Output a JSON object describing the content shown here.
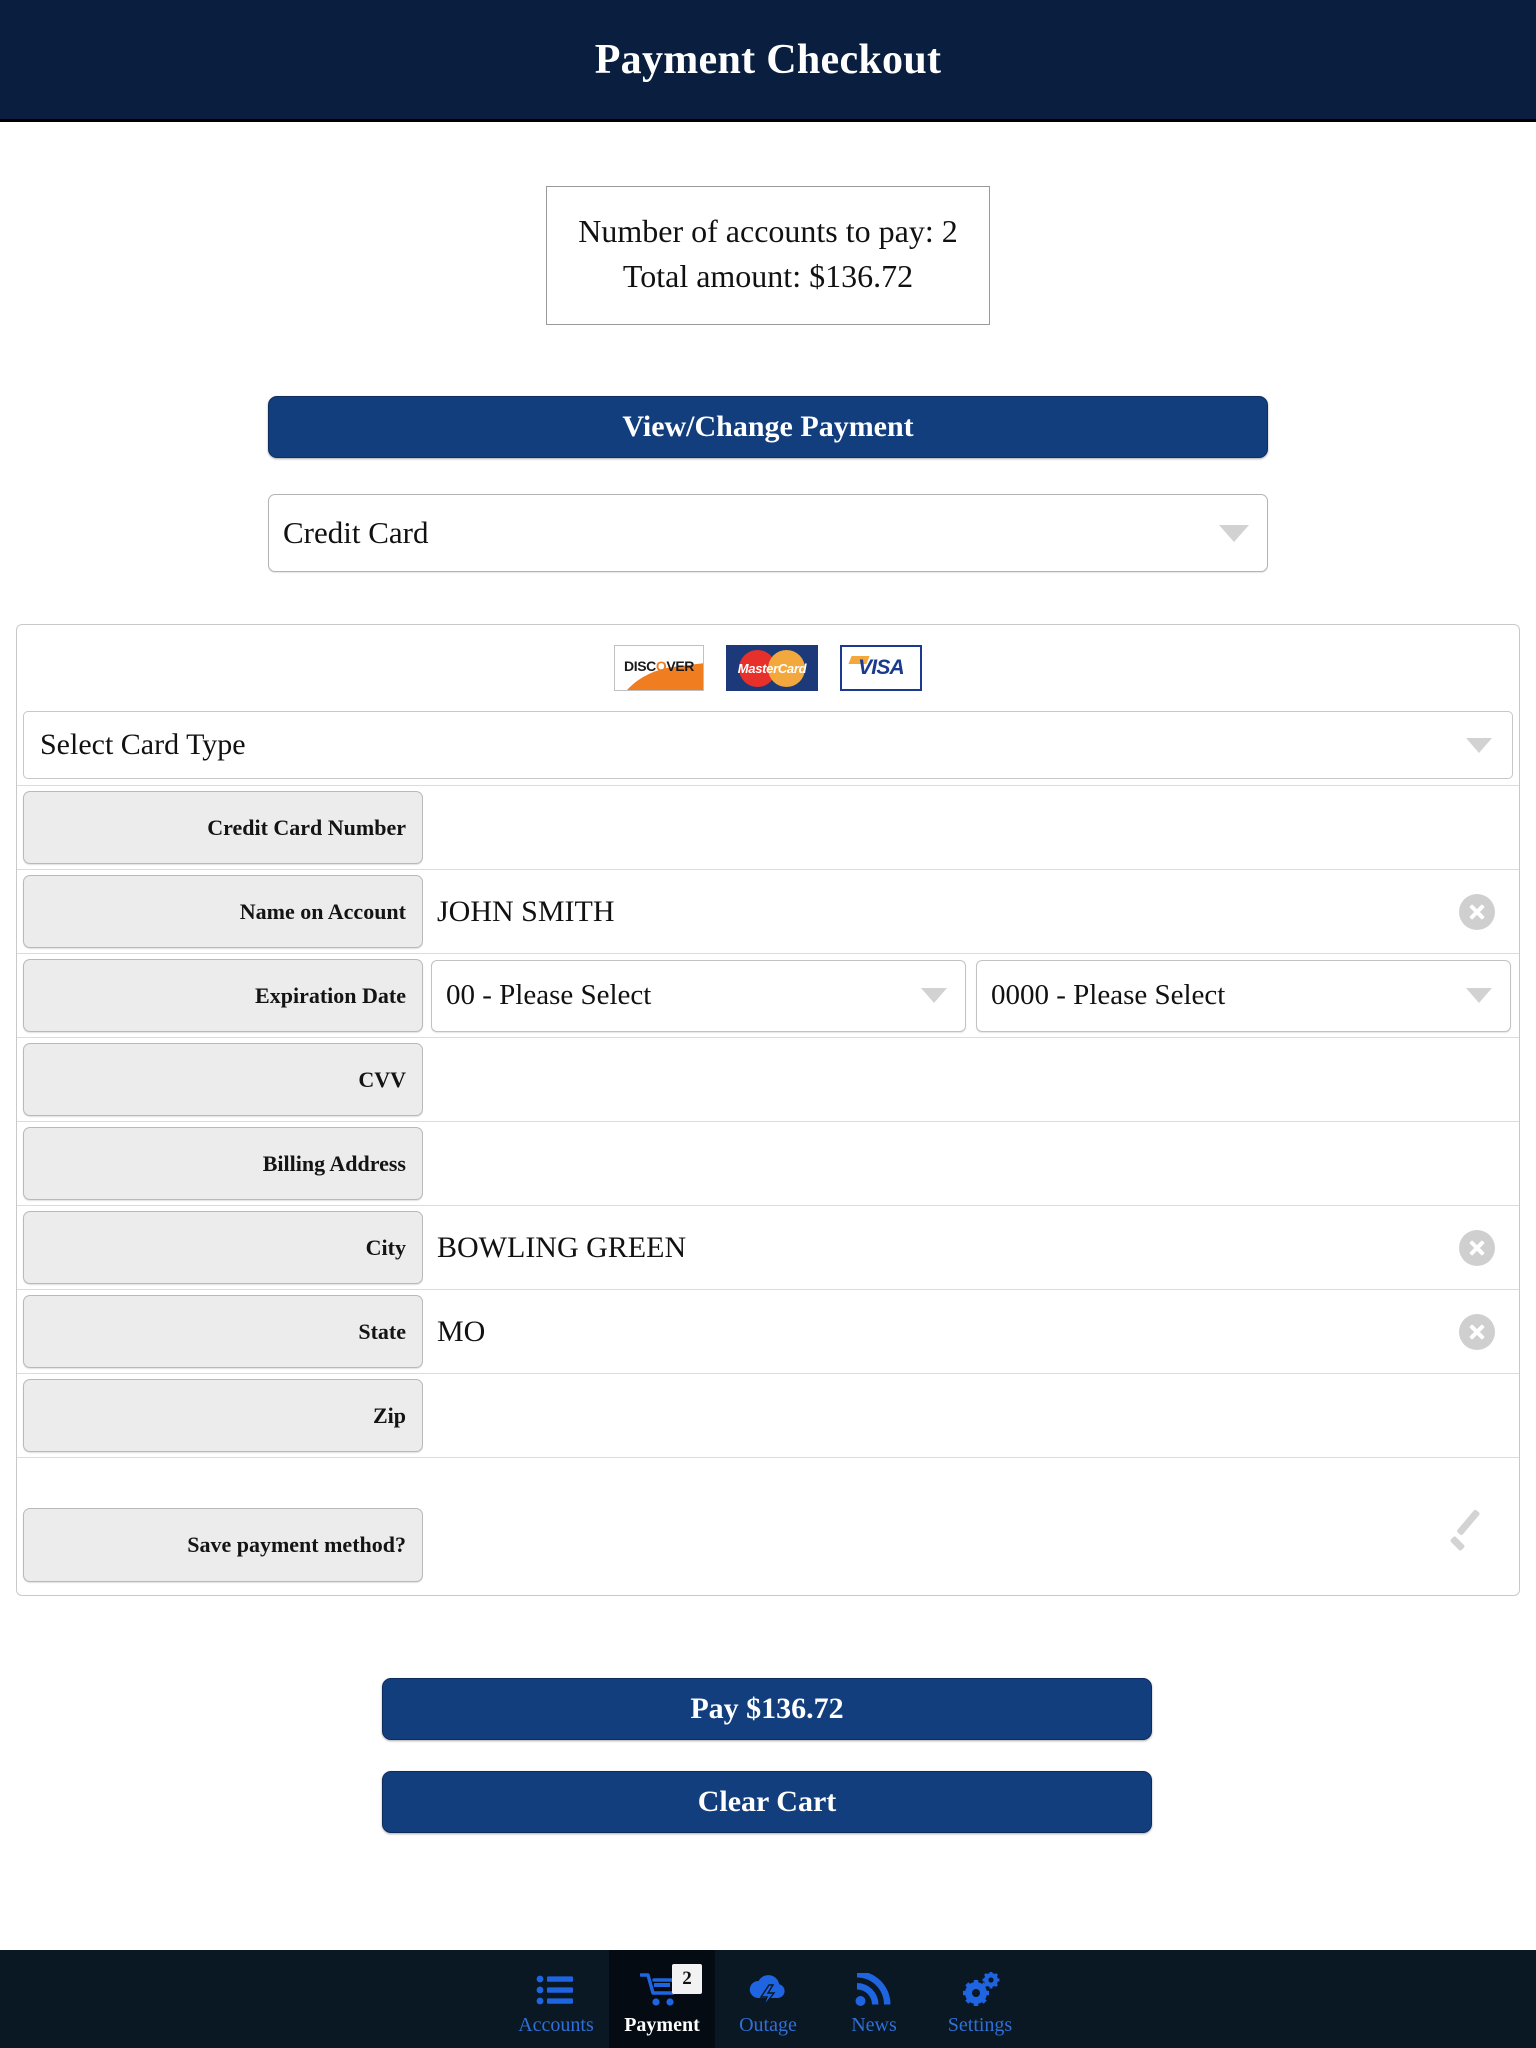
{
  "header": {
    "title": "Payment Checkout"
  },
  "summary": {
    "accounts_line": "Number of accounts to pay: 2",
    "total_line": "Total amount: $136.72",
    "accounts_count": 2,
    "total_amount": "$136.72"
  },
  "actions": {
    "view_change_payment": "View/Change Payment",
    "pay": "Pay $136.72",
    "clear_cart": "Clear Cart"
  },
  "payment_method_select": {
    "value": "Credit Card",
    "icon": "chevron-down-icon"
  },
  "card_panel": {
    "logos": [
      {
        "name": "discover-logo",
        "label": "DISCOVER"
      },
      {
        "name": "mastercard-logo",
        "label": "MasterCard"
      },
      {
        "name": "visa-logo",
        "label": "VISA"
      }
    ],
    "card_type_select": {
      "value": "Select Card Type"
    },
    "fields": [
      {
        "label": "Credit Card Number",
        "value": "",
        "clear": false
      },
      {
        "label": "Name on Account",
        "value": "JOHN SMITH",
        "clear": true
      },
      {
        "label": "CVV",
        "value": "",
        "clear": false
      },
      {
        "label": "Billing Address",
        "value": "",
        "clear": false
      },
      {
        "label": "City",
        "value": "BOWLING GREEN",
        "clear": true
      },
      {
        "label": "State",
        "value": "MO",
        "clear": true
      },
      {
        "label": "Zip",
        "value": "",
        "clear": false
      }
    ],
    "expiration": {
      "label": "Expiration Date",
      "month_value": "00 - Please Select",
      "year_value": "0000 - Please Select"
    },
    "save_method": {
      "label": "Save payment method?",
      "icon": "check-icon"
    }
  },
  "tabbar": {
    "items": [
      {
        "label": "Accounts",
        "icon": "list-icon",
        "active": false,
        "badge": null
      },
      {
        "label": "Payment",
        "icon": "shopping-cart-icon",
        "active": true,
        "badge": "2"
      },
      {
        "label": "Outage",
        "icon": "storm-cloud-icon",
        "active": false,
        "badge": null
      },
      {
        "label": "News",
        "icon": "rss-icon",
        "active": false,
        "badge": null
      },
      {
        "label": "Settings",
        "icon": "gear-icon",
        "active": false,
        "badge": null
      }
    ]
  },
  "colors": {
    "header_bg": "#0a1f3f",
    "button_bg": "#123e7e",
    "tabbar_bg": "#0a1824",
    "tab_active_bg": "#050b12",
    "tab_label": "#2f6fd8"
  }
}
